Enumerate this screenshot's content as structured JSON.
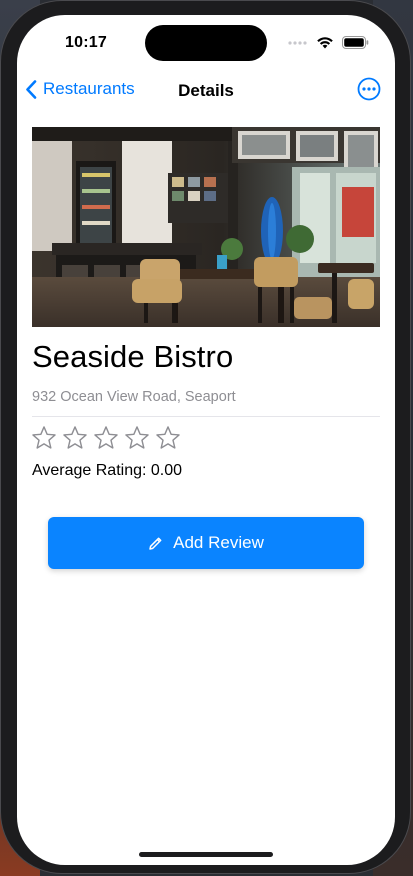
{
  "status": {
    "time": "10:17"
  },
  "nav": {
    "back_label": "Restaurants",
    "title": "Details"
  },
  "restaurant": {
    "name": "Seaside Bistro",
    "address": "932 Ocean View Road, Seaport",
    "rating_max": 5,
    "rating": 0,
    "average_rating_label": "Average Rating: 0.00"
  },
  "actions": {
    "add_review_label": "Add Review"
  },
  "colors": {
    "accent": "#007aff",
    "button": "#0a84ff",
    "secondary_text": "#8e8e93"
  },
  "icons": {
    "back": "chevron-left-icon",
    "more": "ellipsis-circle-icon",
    "star": "star-outline-icon",
    "edit": "pencil-icon"
  }
}
